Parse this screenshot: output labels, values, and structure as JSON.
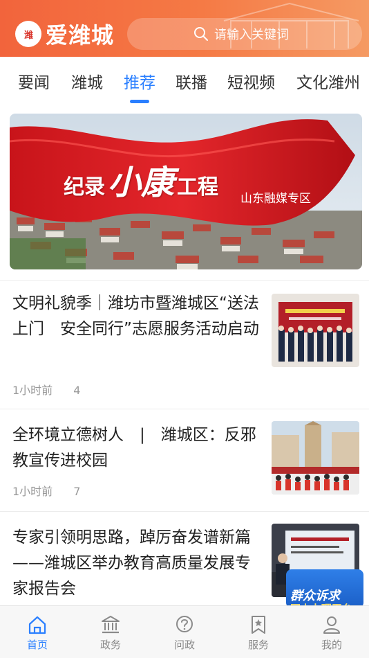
{
  "header": {
    "logo_mark": "潍",
    "app_name": "爱潍城",
    "search_placeholder": "请输入关键词"
  },
  "tabs": [
    {
      "label": "要闻"
    },
    {
      "label": "潍城"
    },
    {
      "label": "推荐",
      "active": true
    },
    {
      "label": "联播"
    },
    {
      "label": "短视频"
    },
    {
      "label": "文化潍州"
    }
  ],
  "banner": {
    "title_part1": "纪录",
    "title_part2": "小康",
    "title_part3": "工程",
    "subtitle": "山东融媒专区"
  },
  "news": [
    {
      "title": "文明礼貌季｜潍坊市暨潍城区“送法上门　安全同行”志愿服务活动启动",
      "time": "1小时前",
      "count": "4",
      "thumb": "ceremony-photo"
    },
    {
      "title": "全环境立德树人　|　潍城区：反邪教宣传进校园",
      "time": "1小时前",
      "count": "7",
      "thumb": "school-photo"
    },
    {
      "title": "专家引领明思路，踔厉奋发谱新篇——潍城区举办教育高质量发展专家报告会",
      "thumb": "lecture-photo"
    }
  ],
  "float_badge": {
    "line1": "群众诉求",
    "line2": "网上办理平台"
  },
  "bottom_nav": [
    {
      "label": "首页",
      "icon": "home-icon",
      "active": true
    },
    {
      "label": "政务",
      "icon": "government-icon"
    },
    {
      "label": "问政",
      "icon": "question-icon"
    },
    {
      "label": "服务",
      "icon": "bookmark-star-icon"
    },
    {
      "label": "我的",
      "icon": "user-icon"
    }
  ],
  "colors": {
    "accent": "#2a7fff",
    "header_orange": "#f2643c"
  }
}
